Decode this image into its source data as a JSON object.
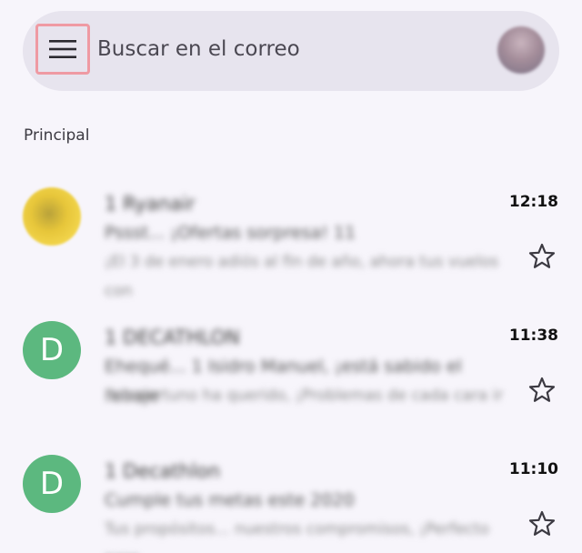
{
  "search": {
    "placeholder": "Buscar en el correo",
    "menu_icon": "hamburger-menu-icon",
    "highlight_color": "#ef9aa3"
  },
  "section": {
    "label": "Principal"
  },
  "emails": [
    {
      "sender": "1 Ryanair",
      "subject": "Pssst... ¡Ofertas sorpresa! 11",
      "snippet": "¡El 3 de enero adiós al fin de año, ahora tus vuelos con",
      "time": "12:18",
      "avatar_letter": "",
      "avatar_color": "#e7c63a"
    },
    {
      "sender": "1 DECATHLON",
      "subject": "Ehequé... 1 Isidro Manuel, ¡está sabido el rebaje",
      "snippet": "Es oportuno ha querido, ¡Problemas de cada cara ir",
      "time": "11:38",
      "avatar_letter": "D",
      "avatar_color": "#5cb87f"
    },
    {
      "sender": "1 Decathlon",
      "subject": "Cumple tus metas este 2020",
      "snippet": "Tus propósitos... nuestros compromisos, ¡Perfecto para",
      "time": "11:10",
      "avatar_letter": "D",
      "avatar_color": "#5cb87f"
    }
  ]
}
